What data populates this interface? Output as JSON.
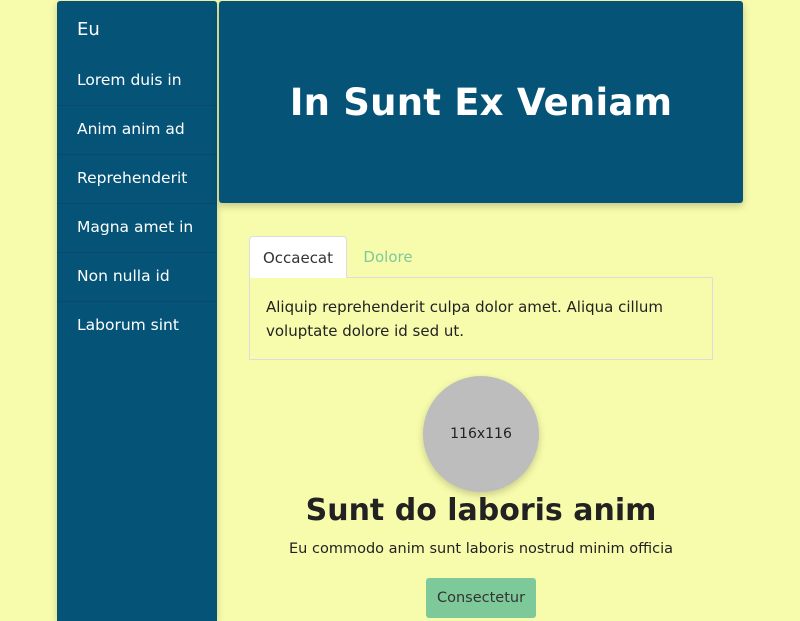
{
  "sidebar": {
    "brand": "Eu",
    "items": [
      {
        "label": "Lorem duis in"
      },
      {
        "label": "Anim anim ad"
      },
      {
        "label": "Reprehenderit"
      },
      {
        "label": "Magna amet in"
      },
      {
        "label": "Non nulla id"
      },
      {
        "label": "Laborum sint"
      }
    ]
  },
  "hero": {
    "title": "In Sunt Ex Veniam"
  },
  "tabs": {
    "items": [
      {
        "label": "Occaecat",
        "active": true
      },
      {
        "label": "Dolore",
        "active": false
      }
    ],
    "panel_text": "Aliquip reprehenderit culpa dolor amet. Aliqua cillum voluptate dolore id sed ut."
  },
  "profile": {
    "avatar_text": "116x116",
    "name": "Sunt do laboris anim",
    "description": "Eu commodo anim sunt laboris nostrud minim officia",
    "button_label": "Consectetur"
  },
  "colors": {
    "page_background": "#f7fcac",
    "primary": "#055478",
    "accent": "#7ec99a",
    "avatar_placeholder": "#bdbdbd"
  }
}
